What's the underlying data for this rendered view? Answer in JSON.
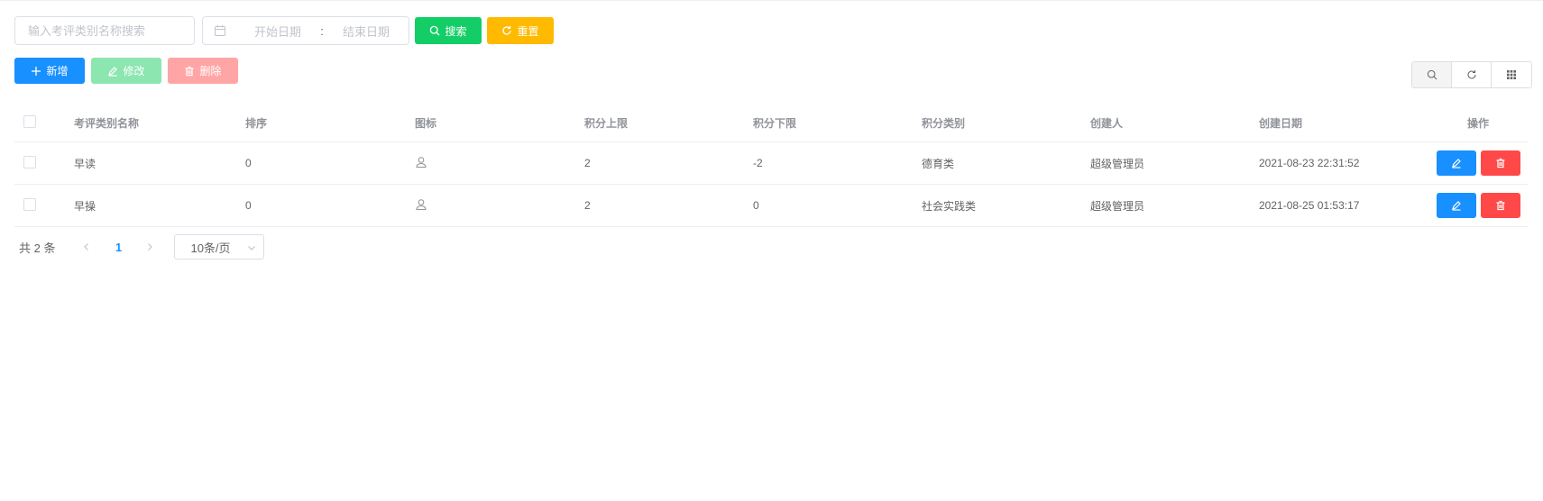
{
  "search": {
    "name_placeholder": "输入考评类别名称搜索",
    "start_placeholder": "开始日期",
    "range_separator": ":",
    "end_placeholder": "结束日期",
    "search_label": "搜索",
    "reset_label": "重置"
  },
  "toolbar": {
    "add_label": "新增",
    "edit_label": "修改",
    "delete_label": "删除"
  },
  "table": {
    "columns": [
      "考评类别名称",
      "排序",
      "图标",
      "积分上限",
      "积分下限",
      "积分类别",
      "创建人",
      "创建日期",
      "操作"
    ],
    "rows": [
      {
        "name": "早读",
        "sort": "0",
        "icon": "user-icon",
        "upper": "2",
        "lower": "-2",
        "category": "德育类",
        "creator": "超级管理员",
        "created": "2021-08-23 22:31:52"
      },
      {
        "name": "早操",
        "sort": "0",
        "icon": "user-icon",
        "upper": "2",
        "lower": "0",
        "category": "社会实践类",
        "creator": "超级管理员",
        "created": "2021-08-25 01:53:17"
      }
    ]
  },
  "pagination": {
    "total": "共 2 条",
    "current_page": "1",
    "page_size": "10条/页"
  },
  "colors": {
    "primary": "#1890ff",
    "success": "#13ce66",
    "warning": "#ffba00",
    "danger": "#ff4949"
  }
}
